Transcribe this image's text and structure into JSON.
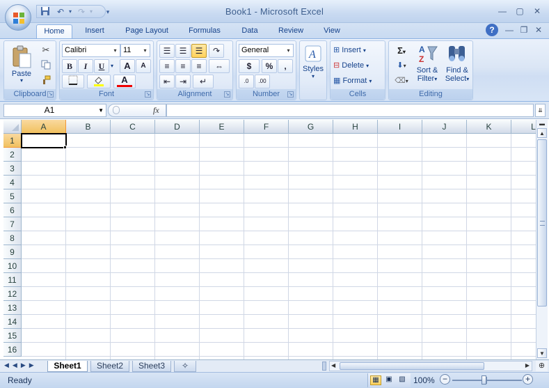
{
  "window": {
    "title": "Book1 - Microsoft Excel"
  },
  "quick_access": {
    "save_icon": "save-icon",
    "undo_icon": "undo-icon",
    "redo_icon": "redo-icon",
    "customize_icon": "customize-qat-icon"
  },
  "tabs": [
    {
      "label": "Home",
      "active": true
    },
    {
      "label": "Insert",
      "active": false
    },
    {
      "label": "Page Layout",
      "active": false
    },
    {
      "label": "Formulas",
      "active": false
    },
    {
      "label": "Data",
      "active": false
    },
    {
      "label": "Review",
      "active": false
    },
    {
      "label": "View",
      "active": false
    }
  ],
  "ribbon": {
    "clipboard": {
      "label": "Clipboard",
      "paste": "Paste"
    },
    "font": {
      "label": "Font",
      "name": "Calibri",
      "size": "11",
      "bold": "B",
      "italic": "I",
      "underline": "U",
      "grow": "A",
      "shrink": "A",
      "font_color_letter": "A"
    },
    "alignment": {
      "label": "Alignment"
    },
    "number": {
      "label": "Number",
      "format": "General",
      "currency": "$",
      "percent": "%",
      "comma": ","
    },
    "styles": {
      "label": "Styles"
    },
    "cells": {
      "label": "Cells",
      "insert": "Insert",
      "delete": "Delete",
      "format": "Format"
    },
    "editing": {
      "label": "Editing",
      "sort_filter_1": "Sort &",
      "sort_filter_2": "Filter",
      "find_select_1": "Find &",
      "find_select_2": "Select",
      "sigma": "Σ"
    }
  },
  "formula_bar": {
    "name_box": "A1",
    "fx": "fx",
    "value": ""
  },
  "sheet": {
    "columns": [
      "A",
      "B",
      "C",
      "D",
      "E",
      "F",
      "G",
      "H",
      "I",
      "J",
      "K",
      "L"
    ],
    "rows": [
      "1",
      "2",
      "3",
      "4",
      "5",
      "6",
      "7",
      "8",
      "9",
      "10",
      "11",
      "12",
      "13",
      "14",
      "15",
      "16"
    ],
    "active_cell": "A1"
  },
  "sheet_tabs": [
    {
      "label": "Sheet1",
      "active": true
    },
    {
      "label": "Sheet2",
      "active": false
    },
    {
      "label": "Sheet3",
      "active": false
    }
  ],
  "status": {
    "text": "Ready",
    "zoom": "100%"
  },
  "colors": {
    "accent": "#15428b",
    "selection_header": "#f1c15f",
    "ribbon_blue": "#dbe6f5"
  }
}
